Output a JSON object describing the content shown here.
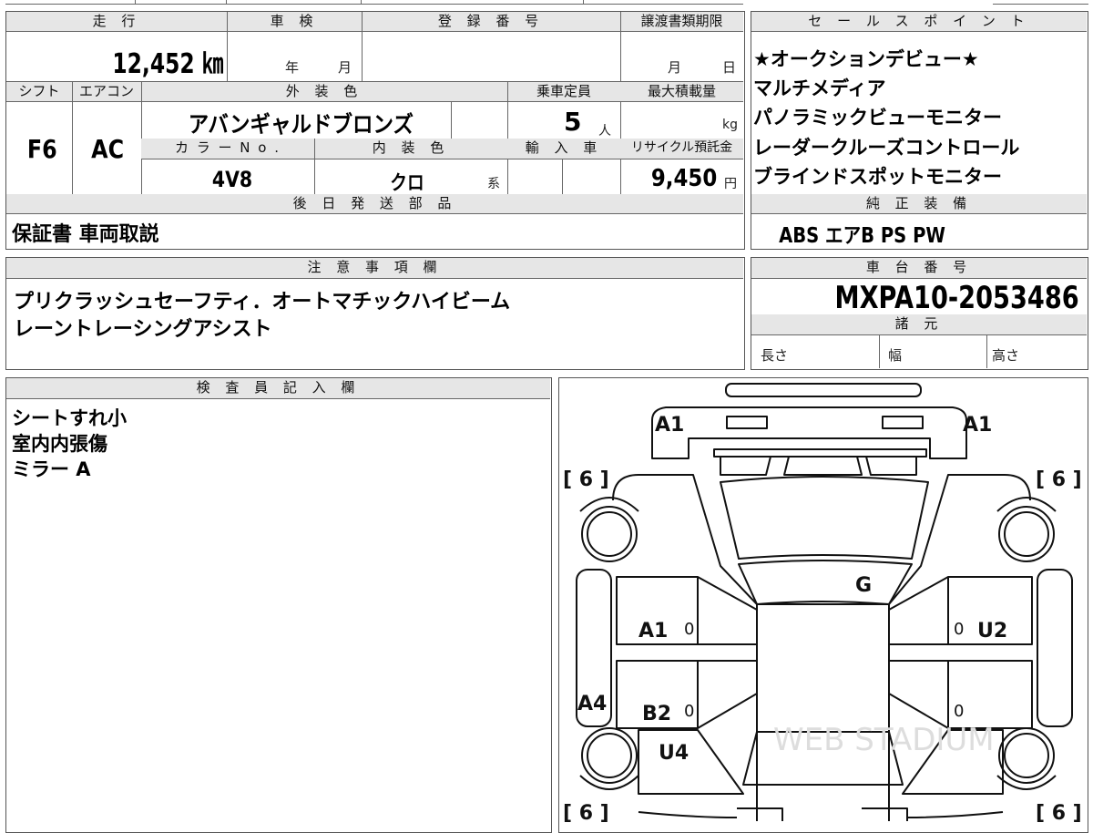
{
  "mileage": {
    "header": "走 行",
    "value": "12,452 ㎞"
  },
  "inspection": {
    "header": "車 検",
    "year_label": "年",
    "month_label": "月"
  },
  "registration": {
    "header": "登 録 番 号"
  },
  "transfer_deadline": {
    "header": "譲渡書類期限",
    "month_label": "月",
    "day_label": "日"
  },
  "shift": {
    "header": "シフト",
    "value": "F6"
  },
  "aircon": {
    "header": "エアコン",
    "value": "AC"
  },
  "exterior_color": {
    "header": "外 装 色",
    "value": "アバンギャルドブロンズ"
  },
  "capacity": {
    "header": "乗車定員",
    "value": "5",
    "unit": "人"
  },
  "max_load": {
    "header": "最大積載量",
    "unit": "kg"
  },
  "color_no": {
    "header": "カ ラ ー N o .",
    "value": "4V8"
  },
  "interior_color": {
    "header": "内 装 色",
    "value": "クロ",
    "unit": "系"
  },
  "import_car": {
    "header": "輸 入 車"
  },
  "recycle": {
    "header": "リサイクル預託金",
    "value": "9,450",
    "unit": "円"
  },
  "later_parts": {
    "header": "後 日 発 送 部 品",
    "value": "保証書 車両取説"
  },
  "sales_points": {
    "header": "セ ー ル ス ポ イ ン ト",
    "items": [
      "★オークションデビュー★",
      "マルチメディア",
      "パノラミックビューモニター",
      "レーダークルーズコントロール",
      "ブラインドスポットモニター"
    ]
  },
  "genuine_equipment": {
    "header": "純 正 装 備",
    "value": "ABS エアB PS PW"
  },
  "notes": {
    "header": "注 意 事 項 欄",
    "lines": [
      "プリクラッシュセーフティ．オートマチックハイビーム",
      "レーントレーシングアシスト"
    ]
  },
  "chassis": {
    "header": "車 台 番 号",
    "value": "MXPA10-2053486"
  },
  "specs": {
    "header": "諸 元",
    "length_label": "長さ",
    "width_label": "幅",
    "height_label": "高さ"
  },
  "inspector": {
    "header": "検 査 員 記 入 欄",
    "lines": [
      "シートすれ小",
      "室内内張傷",
      "ミラー A"
    ]
  },
  "diagram": {
    "marks": {
      "front_left_mirror": "A1",
      "front_right_mirror": "A1",
      "roof": "G",
      "left_front_door": "A1",
      "right_front_door": "U2",
      "left_rear_door": "B2",
      "left_rocker": "A4",
      "left_rear_fender": "U4"
    },
    "tire_tread": [
      "[ 6 ]",
      "[ 6 ]",
      "[ 6 ]",
      "[ 6 ]"
    ],
    "zero": "0",
    "watermark": "WEB STADIUM"
  }
}
